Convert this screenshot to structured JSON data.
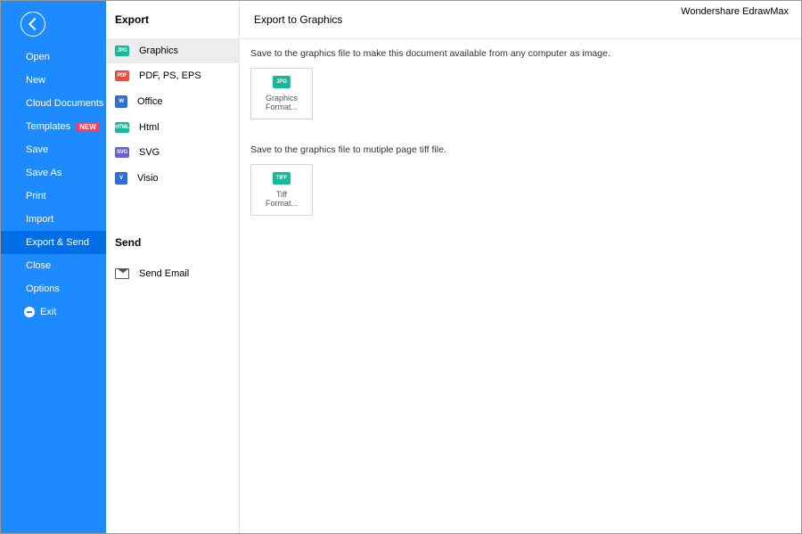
{
  "app_title": "Wondershare EdrawMax",
  "sidebar": {
    "items": [
      {
        "label": "Open"
      },
      {
        "label": "New"
      },
      {
        "label": "Cloud Documents"
      },
      {
        "label": "Templates",
        "badge": "NEW"
      },
      {
        "label": "Save"
      },
      {
        "label": "Save As"
      },
      {
        "label": "Print"
      },
      {
        "label": "Import"
      },
      {
        "label": "Export & Send"
      },
      {
        "label": "Close"
      },
      {
        "label": "Options"
      },
      {
        "label": "Exit"
      }
    ]
  },
  "mid": {
    "export_heading": "Export",
    "send_heading": "Send",
    "export_items": [
      {
        "label": "Graphics",
        "icon": "JPG"
      },
      {
        "label": "PDF, PS, EPS",
        "icon": "PDF"
      },
      {
        "label": "Office",
        "icon": "W"
      },
      {
        "label": "Html",
        "icon": "HTML"
      },
      {
        "label": "SVG",
        "icon": "SVG"
      },
      {
        "label": "Visio",
        "icon": "V"
      }
    ],
    "send_items": [
      {
        "label": "Send Email"
      }
    ]
  },
  "main": {
    "header": "Export to Graphics",
    "desc1": "Save to the graphics file to make this document available from any computer as image.",
    "desc2": "Save to the graphics file to mutiple page tiff file.",
    "card1": {
      "label_l1": "Graphics",
      "label_l2": "Format...",
      "icon": "JPG"
    },
    "card2": {
      "label_l1": "Tiff",
      "label_l2": "Format...",
      "icon": "TIFF"
    }
  }
}
